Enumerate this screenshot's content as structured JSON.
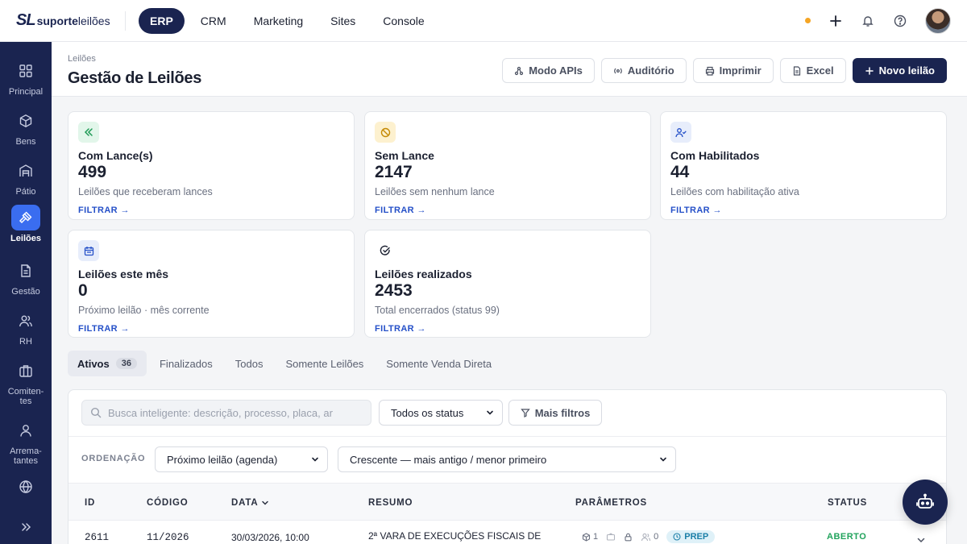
{
  "brand": {
    "mark": "SL",
    "name_bold": "suporte",
    "name_regular": "leilões"
  },
  "topnav": [
    "ERP",
    "CRM",
    "Marketing",
    "Sites",
    "Console"
  ],
  "topnav_active": "ERP",
  "sidebar": [
    {
      "label": "Principal",
      "icon": "grid-icon"
    },
    {
      "label": "Bens",
      "icon": "box-icon"
    },
    {
      "label": "Pátio",
      "icon": "warehouse-icon"
    },
    {
      "label": "Leilões",
      "icon": "gavel-icon",
      "active": true
    },
    {
      "label": "Gestão",
      "icon": "document-icon"
    },
    {
      "label": "RH",
      "icon": "users-icon"
    },
    {
      "label": "Comiten-tes",
      "line1": "Comiten-",
      "line2": "tes",
      "icon": "briefcase-icon"
    },
    {
      "label": "Arrematantes",
      "line1": "Arrema-",
      "line2": "tantes",
      "icon": "user-icon"
    },
    {
      "label": "",
      "icon": "globe-icon"
    }
  ],
  "header": {
    "breadcrumb": "Leilões",
    "title": "Gestão de Leilões",
    "actions": {
      "apis": "Modo APIs",
      "audit": "Auditório",
      "print": "Imprimir",
      "excel": "Excel",
      "new": "Novo leilão"
    }
  },
  "cards": [
    {
      "title": "Com Lance(s)",
      "value": "499",
      "desc": "Leilões que receberam lances",
      "link": "FILTRAR →",
      "icon": "chevrons-left-icon",
      "color": "#e2f6ea",
      "icon_color": "#1e9a55"
    },
    {
      "title": "Sem Lance",
      "value": "2147",
      "desc": "Leilões sem nenhum lance",
      "link": "FILTRAR →",
      "icon": "ban-icon",
      "color": "#fdf1cf",
      "icon_color": "#c58a05"
    },
    {
      "title": "Com Habilitados",
      "value": "44",
      "desc": "Leilões com habilitação ativa",
      "link": "FILTRAR →",
      "icon": "user-check-icon",
      "color": "#e7edfb",
      "icon_color": "#2550c8"
    },
    {
      "title": "Leilões este mês",
      "value": "0",
      "desc": "Próximo leilão · mês corrente",
      "link": "FILTRAR →",
      "icon": "calendar-icon",
      "color": "#e7edfb",
      "icon_color": "#2550c8"
    },
    {
      "title": "Leilões realizados",
      "value": "2453",
      "desc": "Total encerrados (status 99)",
      "link": "FILTRAR →",
      "icon": "check-circle-icon",
      "color": "#ffffff",
      "icon_color": "#1b2030"
    }
  ],
  "tabs": [
    {
      "label": "Ativos",
      "count": "36",
      "active": true
    },
    {
      "label": "Finalizados"
    },
    {
      "label": "Todos"
    },
    {
      "label": "Somente Leilões"
    },
    {
      "label": "Somente Venda Direta"
    }
  ],
  "filters": {
    "search_placeholder": "Busca inteligente: descrição, processo, placa, ar",
    "status_select": "Todos os status",
    "more_filters": "Mais filtros",
    "order_label": "ORDENAÇÃO",
    "order_by": "Próximo leilão (agenda)",
    "order_dir": "Crescente — mais antigo / menor primeiro"
  },
  "table": {
    "columns": [
      "ID",
      "CÓDIGO",
      "DATA",
      "RESUMO",
      "PARÂMETROS",
      "STATUS"
    ],
    "rows": [
      {
        "id": "2611",
        "code": "11/2026",
        "date": "30/03/2026, 10:00",
        "summary": "2ª VARA DE EXECUÇÕES FISCAIS DE",
        "lots": "1",
        "habilitados": "0",
        "badge": "PREP",
        "status": "ABERTO"
      }
    ]
  }
}
